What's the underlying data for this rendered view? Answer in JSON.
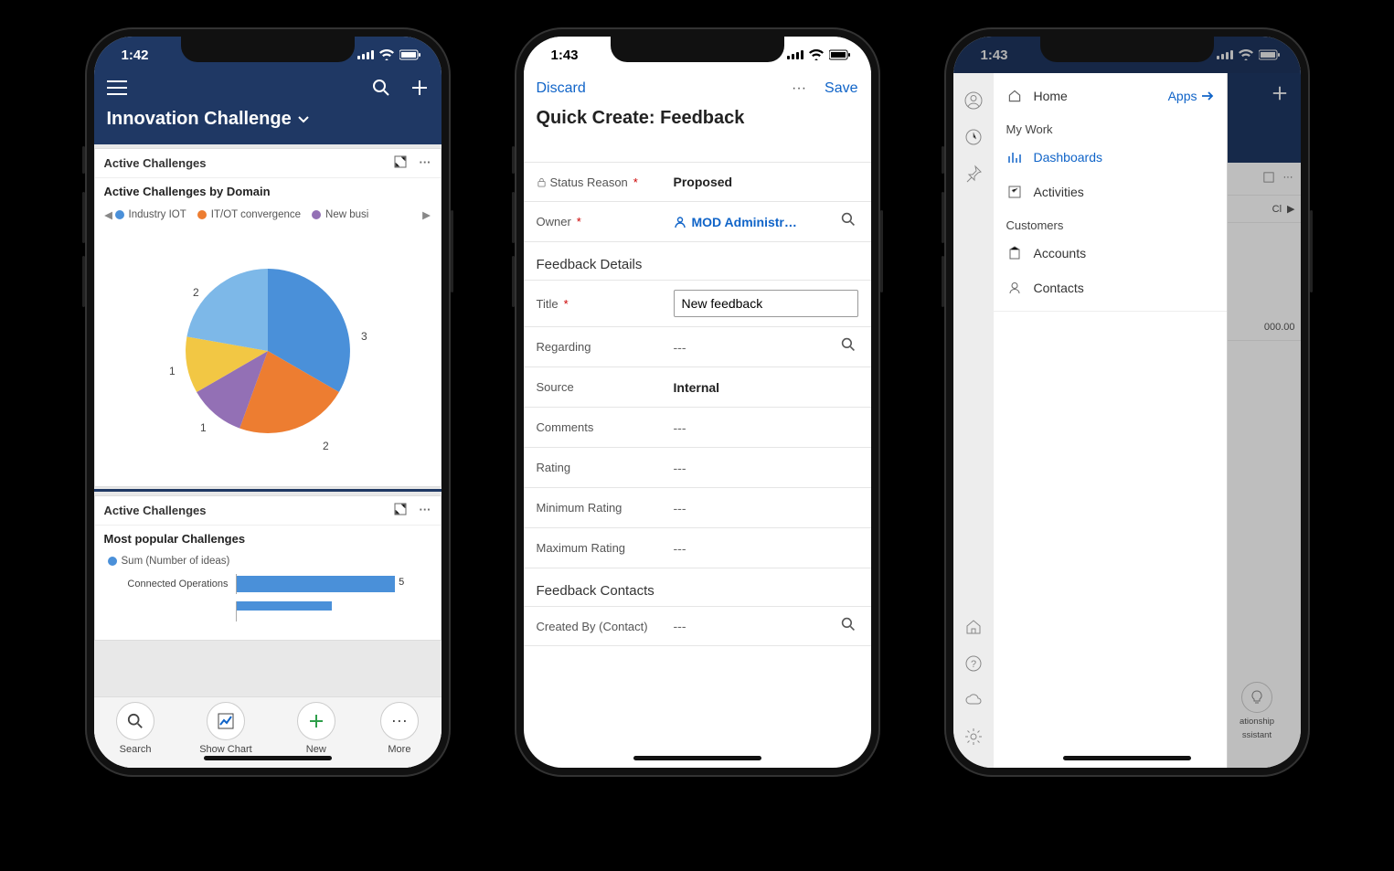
{
  "status": {
    "time1": "1:42",
    "time2": "1:43",
    "time3": "1:43"
  },
  "phone1": {
    "title": "Innovation Challenge",
    "card1": {
      "header": "Active Challenges",
      "subheader": "Active Challenges by Domain",
      "legend": [
        "Industry IOT",
        "IT/OT convergence",
        "New busi"
      ]
    },
    "card2": {
      "header": "Active Challenges",
      "subheader": "Most popular Challenges",
      "legend": "Sum (Number of ideas)",
      "bar_label": "Connected Operations"
    },
    "tabs": {
      "search": "Search",
      "chart": "Show Chart",
      "new": "New",
      "more": "More"
    }
  },
  "phone2": {
    "discard": "Discard",
    "save": "Save",
    "title": "Quick Create: Feedback",
    "sections": {
      "details": "Feedback Details",
      "contacts": "Feedback Contacts"
    },
    "fields": {
      "status_reason": {
        "label": "Status Reason",
        "value": "Proposed"
      },
      "owner": {
        "label": "Owner",
        "value": "MOD Administr…"
      },
      "title": {
        "label": "Title",
        "value": "New feedback"
      },
      "regarding": {
        "label": "Regarding",
        "value": "---"
      },
      "source": {
        "label": "Source",
        "value": "Internal"
      },
      "comments": {
        "label": "Comments",
        "value": "---"
      },
      "rating": {
        "label": "Rating",
        "value": "---"
      },
      "min_rating": {
        "label": "Minimum Rating",
        "value": "---"
      },
      "max_rating": {
        "label": "Maximum Rating",
        "value": "---"
      },
      "created_by": {
        "label": "Created By (Contact)",
        "value": "---"
      }
    }
  },
  "phone3": {
    "home": "Home",
    "apps": "Apps",
    "sections": {
      "mywork": "My Work",
      "customers": "Customers"
    },
    "items": {
      "dashboards": "Dashboards",
      "activities": "Activities",
      "accounts": "Accounts",
      "contacts": "Contacts"
    },
    "tease": {
      "cl": "Cl",
      "amount": "000.00",
      "assistant1": "ationship",
      "assistant2": "ssistant"
    }
  },
  "chart_data": [
    {
      "type": "pie",
      "title": "Active Challenges by Domain",
      "series": [
        {
          "name": "Industry IOT",
          "value": 3,
          "color": "#4a90d9"
        },
        {
          "name": "IT/OT convergence",
          "value": 2,
          "color": "#ed7d31"
        },
        {
          "name": "New business (purple)",
          "value": 1,
          "color": "#9370b5"
        },
        {
          "name": "Segment 4 (yellow)",
          "value": 1,
          "color": "#f2c744"
        },
        {
          "name": "Segment 5 (light blue)",
          "value": 2,
          "color": "#7db8e8"
        }
      ]
    },
    {
      "type": "bar",
      "title": "Most popular Challenges",
      "xlabel": "Sum (Number of ideas)",
      "categories": [
        "Connected Operations"
      ],
      "values": [
        5
      ],
      "xlim": [
        0,
        6
      ]
    }
  ],
  "colors": {
    "brand_dark": "#1f3864",
    "link_blue": "#1064c8",
    "pie": [
      "#4a90d9",
      "#ed7d31",
      "#9370b5",
      "#f2c744",
      "#7db8e8"
    ]
  }
}
